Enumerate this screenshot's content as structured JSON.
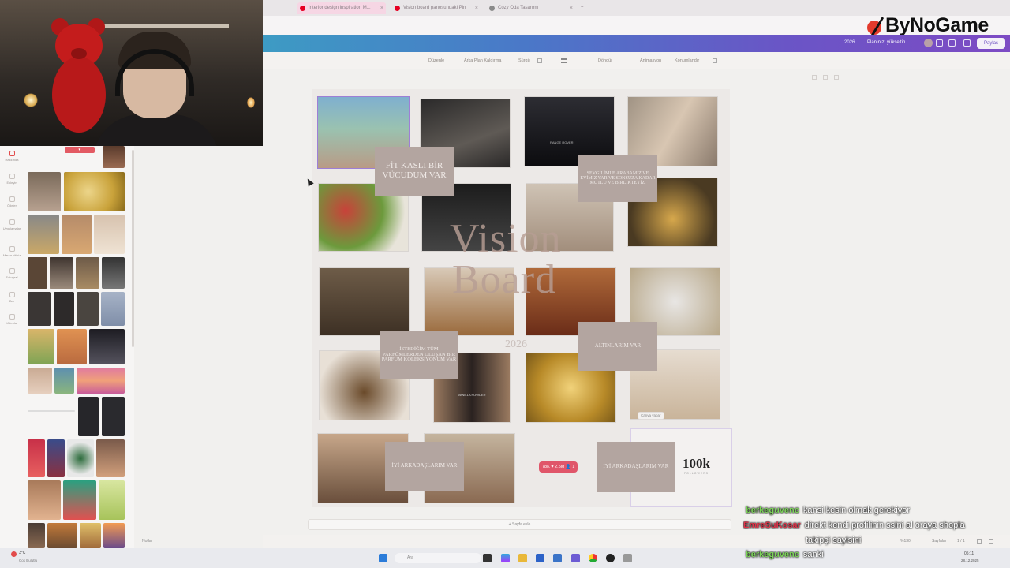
{
  "browser": {
    "tabs": [
      {
        "label": "Interior design inspiration M...",
        "icon_color": "#e60023",
        "active": true
      },
      {
        "label": "Vision board panosundaki Pin",
        "icon_color": "#e60023",
        "active": false
      },
      {
        "label": "Cozy Oda Tasarımı",
        "icon_color": "#7a7a7a",
        "active": false
      }
    ],
    "new_tab": "+",
    "close": "×"
  },
  "logo": {
    "text": "ByNoGame"
  },
  "header": {
    "year": "2026",
    "present": "Planınızı yükseltin",
    "share": "Paylaş"
  },
  "toolbar": {
    "items": [
      "Düzenle",
      "Arka Plan Kaldırma",
      "Sürgü",
      "Döndür",
      "Animasyon",
      "Konumlandır"
    ]
  },
  "rail": {
    "items": [
      "Hakkında",
      "Ekleyin",
      "Öğeler",
      "Uygulamalar",
      "Marka kitiniz",
      "Fotoğraf",
      "Bar",
      "Videolar"
    ]
  },
  "panel": {
    "badge": "♥"
  },
  "board": {
    "title_line1": "Vision",
    "title_line2": "Board",
    "year": "2026",
    "labels": {
      "fit": "FİT KASLI BİR VÜCUDUM VAR",
      "love": "SEVGİLİMLE ARABAMIZ VE EVİMİZ VAR VE SONSUZA KADAR MUTLU VE BİRLİKTEYİZ.",
      "perfume": "İSTEDİĞİM TÜM PARFÜMLERDEN OLUŞAN BİR PARFÜM KOLEKSİYONUM VAR",
      "gold": "ALTINLARIM VAR",
      "friends1": "İYİ ARKADAŞLARIM VAR",
      "friends2": "İYİ ARKADAŞLARIM VAR"
    },
    "followers": "100k",
    "followers_sub": "FOLLOWERS",
    "ig_badge": "78K ♥ 2.5M 👤 1",
    "perfume_text": "VANILLA POWDER",
    "car_plate": "RANGE ROVER",
    "context_toolbar": "Canva yapar"
  },
  "add_page": "+ Sayfa ekle",
  "notes": "Notlar",
  "status": {
    "zoom": "%130",
    "pages_label": "Sayfalar",
    "page_num": "1 / 1"
  },
  "taskbar": {
    "search": "Ara",
    "weather_temp": "3°C",
    "weather_text": "Çok Bulutlu",
    "time": "05:11",
    "date": "28.12.2025"
  },
  "chat": [
    {
      "user": "berkeguvenc",
      "color": "#7cd35a",
      "message": "kansi kesin olmak gerekiyor"
    },
    {
      "user": "EmreSuKosar",
      "color": "#e0344a",
      "message": "direkt kendi profilinin ssini al oraya shopla"
    },
    {
      "user": "",
      "color": "#ffffff",
      "message": "takipçi sayisini"
    },
    {
      "user": "berkeguvenc",
      "color": "#7cd35a",
      "message": "sanki"
    }
  ]
}
